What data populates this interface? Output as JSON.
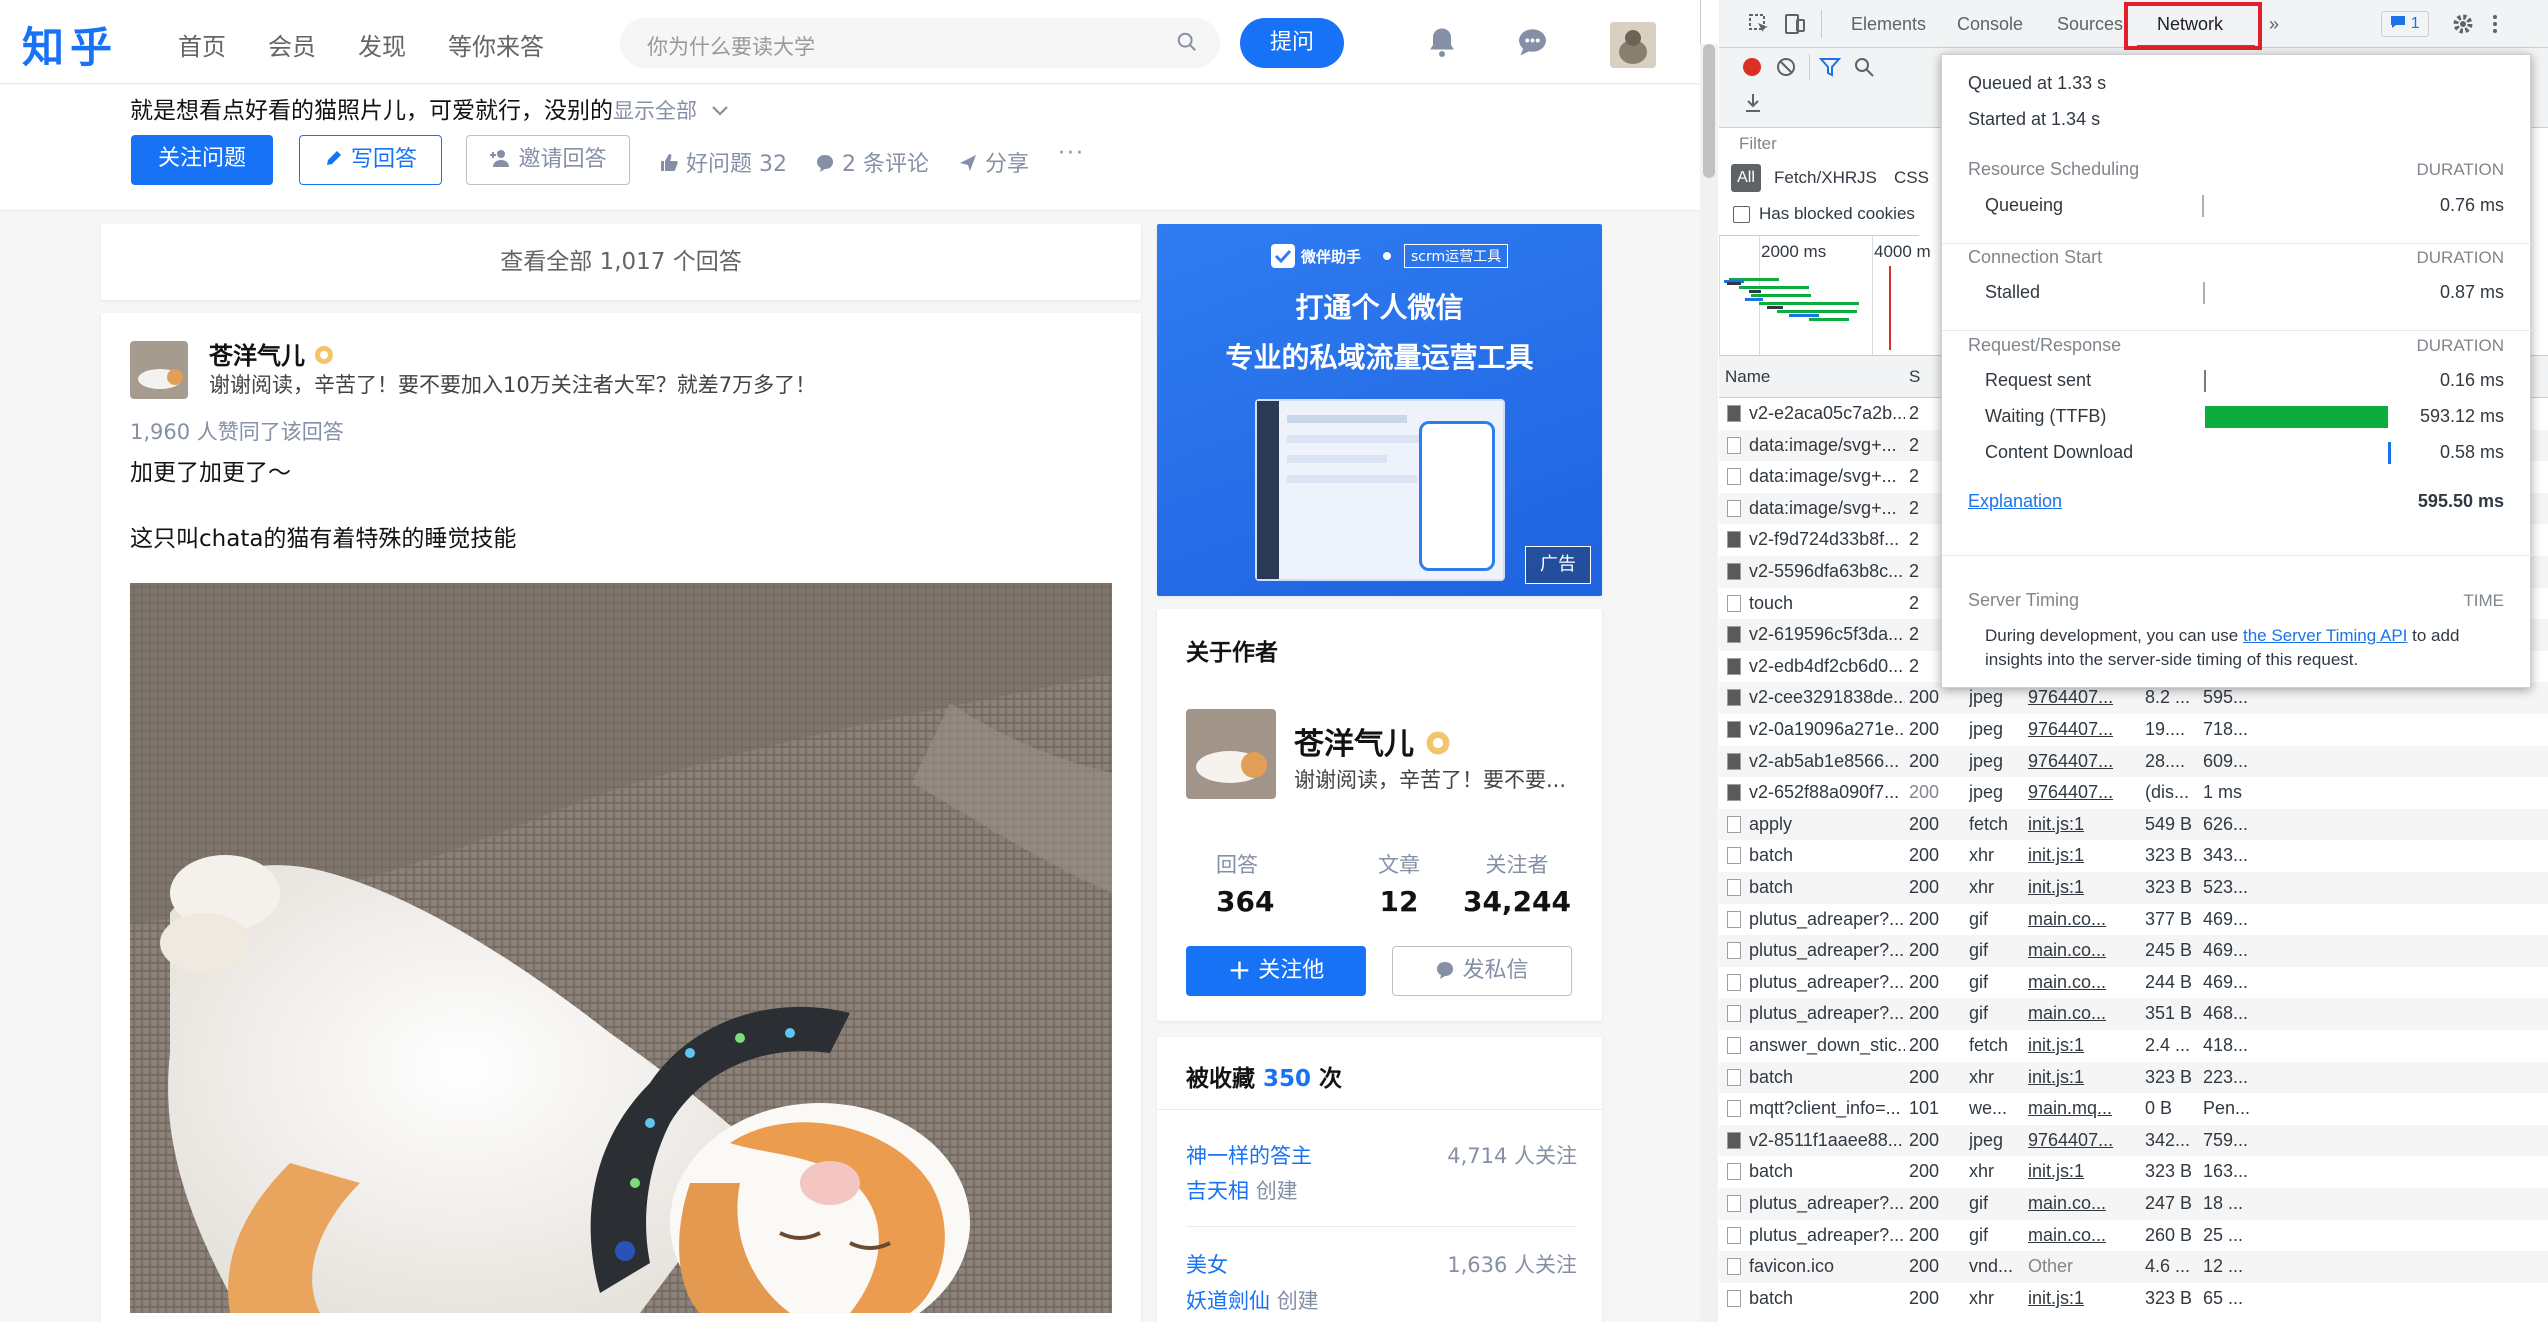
{
  "zhihu": {
    "logo": "知乎",
    "nav": [
      "首页",
      "会员",
      "发现",
      "等你来答"
    ],
    "search_placeholder": "你为什么要读大学",
    "ask_button": "提问",
    "question_desc": "就是想看点好看的猫照片儿，可爱就行，没别的",
    "show_all": "显示全部",
    "follow_question": "关注问题",
    "write_answer": "写回答",
    "invite_answer": "邀请回答",
    "good_question": "好问题 32",
    "comments": "2 条评论",
    "share": "分享",
    "more": "···",
    "view_all_answers": "查看全部 1,017 个回答",
    "answer": {
      "author": "苍洋气儿",
      "bio": "谢谢阅读，辛苦了！要不要加入10万关注者大军？就差7万多了！",
      "agree_count": "1,960 人赞同了该回答",
      "para1": "加更了加更了～",
      "para2": "这只叫chata的猫有着特殊的睡觉技能"
    },
    "ad": {
      "brand": "微伴助手",
      "tag": "scrm运营工具",
      "line1": "打通个人微信",
      "line2": "专业的私域流量运营工具",
      "badge": "广告"
    },
    "about_author": {
      "title": "关于作者",
      "name": "苍洋气儿",
      "bio": "谢谢阅读，辛苦了！要不要...",
      "stats": [
        {
          "label": "回答",
          "value": "364"
        },
        {
          "label": "文章",
          "value": "12"
        },
        {
          "label": "关注者",
          "value": "34,244"
        }
      ],
      "follow_btn": "关注他",
      "message_btn": "发私信"
    },
    "favorites": {
      "title_prefix": "被收藏",
      "count": "350",
      "title_suffix": "次",
      "items": [
        {
          "name": "神一样的答主",
          "creator": "吉天相",
          "created": "创建",
          "followers": "4,714 人关注"
        },
        {
          "name": "美女",
          "creator": "妖道劍仙",
          "created": "创建",
          "followers": "1,636 人关注"
        }
      ]
    }
  },
  "devtools": {
    "tabs": [
      "Elements",
      "Console",
      "Sources",
      "Network"
    ],
    "active_tab": "Network",
    "more_tabs": "»",
    "issue_count": "1",
    "filter_label": "Filter",
    "filter_types": [
      "All",
      "Fetch/XHR",
      "JS",
      "CSS"
    ],
    "blocked_cookies": "Has blocked cookies",
    "overview_ticks": [
      "2000 ms",
      "4000 m"
    ],
    "col_name": "Name",
    "col_status": "S",
    "rows": [
      {
        "name": "v2-e2aca05c7a2b...",
        "status": "2",
        "type": "",
        "init": "",
        "size": "",
        "time": "",
        "icon": "img"
      },
      {
        "name": "data:image/svg+...",
        "status": "2",
        "type": "",
        "init": "",
        "size": "",
        "time": "",
        "icon": "doc"
      },
      {
        "name": "data:image/svg+...",
        "status": "2",
        "type": "",
        "init": "",
        "size": "",
        "time": "",
        "icon": "doc"
      },
      {
        "name": "data:image/svg+...",
        "status": "2",
        "type": "",
        "init": "",
        "size": "",
        "time": "",
        "icon": "doc"
      },
      {
        "name": "v2-f9d724d33b8f...",
        "status": "2",
        "type": "",
        "init": "",
        "size": "",
        "time": "",
        "icon": "img"
      },
      {
        "name": "v2-5596dfa63b8c...",
        "status": "2",
        "type": "",
        "init": "",
        "size": "",
        "time": "",
        "icon": "img"
      },
      {
        "name": "touch",
        "status": "2",
        "type": "",
        "init": "",
        "size": "",
        "time": "",
        "icon": "doc"
      },
      {
        "name": "v2-619596c5f3da...",
        "status": "2",
        "type": "",
        "init": "",
        "size": "",
        "time": "",
        "icon": "img"
      },
      {
        "name": "v2-edb4df2cb6d0...",
        "status": "2",
        "type": "",
        "init": "",
        "size": "",
        "time": "",
        "icon": "img"
      },
      {
        "name": "v2-cee3291838de...",
        "status": "200",
        "type": "jpeg",
        "init": "9764407...",
        "size": "8.2 ...",
        "time": "595...",
        "icon": "img"
      },
      {
        "name": "v2-0a19096a271e...",
        "status": "200",
        "type": "jpeg",
        "init": "9764407...",
        "size": "19....",
        "time": "718...",
        "icon": "img"
      },
      {
        "name": "v2-ab5ab1e8566...",
        "status": "200",
        "type": "jpeg",
        "init": "9764407...",
        "size": "28....",
        "time": "609...",
        "icon": "img"
      },
      {
        "name": "v2-652f88a090f7...",
        "status": "200",
        "type": "jpeg",
        "init": "9764407...",
        "size": "(dis...",
        "time": "1 ms",
        "icon": "img"
      },
      {
        "name": "apply",
        "status": "200",
        "type": "fetch",
        "init": "init.js:1",
        "size": "549 B",
        "time": "626...",
        "icon": "doc"
      },
      {
        "name": "batch",
        "status": "200",
        "type": "xhr",
        "init": "init.js:1",
        "size": "323 B",
        "time": "343...",
        "icon": "doc"
      },
      {
        "name": "batch",
        "status": "200",
        "type": "xhr",
        "init": "init.js:1",
        "size": "323 B",
        "time": "523...",
        "icon": "doc"
      },
      {
        "name": "plutus_adreaper?...",
        "status": "200",
        "type": "gif",
        "init": "main.co...",
        "size": "377 B",
        "time": "469...",
        "icon": "doc"
      },
      {
        "name": "plutus_adreaper?...",
        "status": "200",
        "type": "gif",
        "init": "main.co...",
        "size": "245 B",
        "time": "469...",
        "icon": "doc"
      },
      {
        "name": "plutus_adreaper?...",
        "status": "200",
        "type": "gif",
        "init": "main.co...",
        "size": "244 B",
        "time": "469...",
        "icon": "doc"
      },
      {
        "name": "plutus_adreaper?...",
        "status": "200",
        "type": "gif",
        "init": "main.co...",
        "size": "351 B",
        "time": "468...",
        "icon": "doc"
      },
      {
        "name": "answer_down_stic...",
        "status": "200",
        "type": "fetch",
        "init": "init.js:1",
        "size": "2.4 ...",
        "time": "418...",
        "icon": "doc"
      },
      {
        "name": "batch",
        "status": "200",
        "type": "xhr",
        "init": "init.js:1",
        "size": "323 B",
        "time": "223...",
        "icon": "doc"
      },
      {
        "name": "mqtt?client_info=...",
        "status": "101",
        "type": "we...",
        "init": "main.mq...",
        "size": "0 B",
        "time": "Pen...",
        "icon": "doc"
      },
      {
        "name": "v2-8511f1aaee88...",
        "status": "200",
        "type": "jpeg",
        "init": "9764407...",
        "size": "342...",
        "time": "759...",
        "icon": "img"
      },
      {
        "name": "batch",
        "status": "200",
        "type": "xhr",
        "init": "init.js:1",
        "size": "323 B",
        "time": "163...",
        "icon": "doc"
      },
      {
        "name": "plutus_adreaper?...",
        "status": "200",
        "type": "gif",
        "init": "main.co...",
        "size": "247 B",
        "time": "18 ...",
        "icon": "doc"
      },
      {
        "name": "plutus_adreaper?...",
        "status": "200",
        "type": "gif",
        "init": "main.co...",
        "size": "260 B",
        "time": "25 ...",
        "icon": "doc"
      },
      {
        "name": "favicon.ico",
        "status": "200",
        "type": "vnd...",
        "init": "Other",
        "size": "4.6 ...",
        "time": "12 ...",
        "icon": "doc"
      },
      {
        "name": "batch",
        "status": "200",
        "type": "xhr",
        "init": "init.js:1",
        "size": "323 B",
        "time": "65 ...",
        "icon": "doc"
      }
    ],
    "timing": {
      "queued_at": "Queued at 1.33 s",
      "started_at": "Started at 1.34 s",
      "sections": [
        {
          "title": "Resource Scheduling",
          "dur_label": "DURATION",
          "items": [
            {
              "label": "Queueing",
              "value": "0.76 ms"
            }
          ]
        },
        {
          "title": "Connection Start",
          "dur_label": "DURATION",
          "items": [
            {
              "label": "Stalled",
              "value": "0.87 ms"
            }
          ]
        },
        {
          "title": "Request/Response",
          "dur_label": "DURATION",
          "items": [
            {
              "label": "Request sent",
              "value": "0.16 ms"
            },
            {
              "label": "Waiting (TTFB)",
              "value": "593.12 ms"
            },
            {
              "label": "Content Download",
              "value": "0.58 ms"
            }
          ]
        }
      ],
      "explanation": "Explanation",
      "total": "595.50 ms",
      "server_timing_title": "Server Timing",
      "time_label": "TIME",
      "server_timing_text_1": "During development, you can use ",
      "server_timing_link": "the Server Timing API",
      "server_timing_text_2": " to add",
      "server_timing_text_3": "insights into the server-side timing of this request."
    }
  },
  "colors": {
    "zhihu_blue": "#1772f6",
    "devtools_accent": "#1a73e8",
    "ttfb_green": "#0cac3e",
    "highlight_red": "#e0202a"
  }
}
